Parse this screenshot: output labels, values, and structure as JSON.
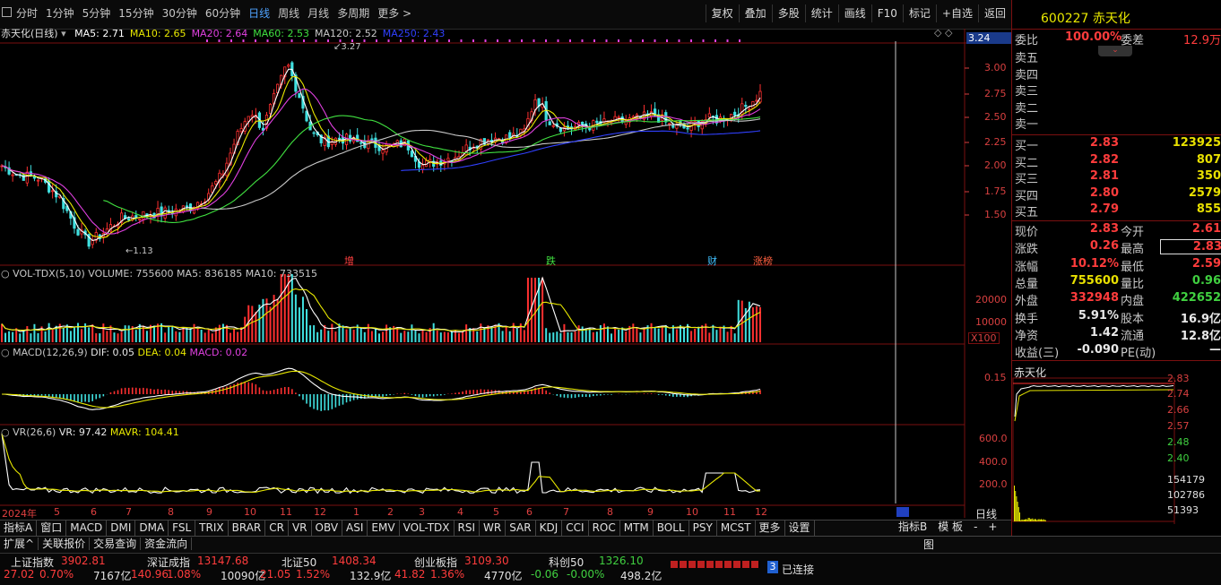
{
  "toolbar": {
    "periods": [
      "分时",
      "1分钟",
      "5分钟",
      "15分钟",
      "30分钟",
      "60分钟",
      "日线",
      "周线",
      "月线",
      "多周期",
      "更多 >"
    ],
    "active_period": "日线",
    "tools": [
      "复权",
      "叠加",
      "多股",
      "统计",
      "画线",
      "F10",
      "标记",
      "+自选",
      "返回"
    ]
  },
  "main_chart": {
    "title": "赤天化(日线)",
    "ma": [
      {
        "label": "MA5: 2.71",
        "color": "#ffffff"
      },
      {
        "label": "MA10: 2.65",
        "color": "#e8e800"
      },
      {
        "label": "MA20: 2.64",
        "color": "#e040e0"
      },
      {
        "label": "MA60: 2.53",
        "color": "#40e040"
      },
      {
        "label": "MA120: 2.52",
        "color": "#c8c8c8"
      },
      {
        "label": "MA250: 2.43",
        "color": "#3040ff"
      }
    ],
    "high_label": "3.27",
    "low_label": "1.13",
    "cursor_price": "3.24",
    "price_ticks": [
      "3.00",
      "2.75",
      "2.50",
      "2.25",
      "2.00",
      "1.75",
      "1.50"
    ],
    "events": [
      {
        "text": "增",
        "color": "#ff4040"
      },
      {
        "text": "跌",
        "color": "#40e040"
      },
      {
        "text": "财",
        "color": "#40c0ff"
      },
      {
        "text": "涨榜",
        "color": "#ff6040"
      }
    ]
  },
  "vol_panel": {
    "title": "VOL-TDX(5,10)",
    "values": "VOLUME: 755600  MA5: 836185  MA10: 733515",
    "ticks": [
      "20000",
      "10000",
      "X100"
    ]
  },
  "macd_panel": {
    "title": "MACD(12,26,9)",
    "dif": "DIF: 0.05",
    "dea": "DEA: 0.04",
    "macd": "MACD: 0.02",
    "ticks": [
      "0.15"
    ]
  },
  "vr_panel": {
    "title": "VR(26,6)",
    "vr": "VR: 97.42",
    "mavr": "MAVR: 104.41",
    "ticks": [
      "600.0",
      "400.0",
      "200.0"
    ]
  },
  "x_axis": [
    "2024年",
    "5",
    "6",
    "7",
    "8",
    "9",
    "10",
    "11",
    "12",
    "1",
    "2",
    "3",
    "4",
    "5",
    "6",
    "7",
    "8",
    "9",
    "10",
    "11",
    "12"
  ],
  "x_axis_right": "日线",
  "indicator_tabs": [
    "指标A",
    "窗口",
    "MACD",
    "DMI",
    "DMA",
    "FSL",
    "TRIX",
    "BRAR",
    "CR",
    "VR",
    "OBV",
    "ASI",
    "EMV",
    "VOL-TDX",
    "RSI",
    "WR",
    "SAR",
    "KDJ",
    "CCI",
    "ROC",
    "MTM",
    "BOLL",
    "PSY",
    "MCST",
    "更多",
    "设置"
  ],
  "indicator_tabs_right": [
    "指标B",
    "模 板",
    "-",
    "+"
  ],
  "bottom_tabs": [
    "扩展^",
    "关联报价",
    "交易查询",
    "资金流向"
  ],
  "bottom_tabs_right": "图",
  "quote": {
    "code": "600227",
    "name": "赤天化",
    "webi_label": "委比",
    "webi": "100.00%",
    "weicha_label": "委差",
    "weicha": "12.9万",
    "sell": [
      {
        "label": "卖五",
        "price": "",
        "vol": ""
      },
      {
        "label": "卖四",
        "price": "",
        "vol": ""
      },
      {
        "label": "卖三",
        "price": "",
        "vol": ""
      },
      {
        "label": "卖二",
        "price": "",
        "vol": ""
      },
      {
        "label": "卖一",
        "price": "",
        "vol": ""
      }
    ],
    "buy": [
      {
        "label": "买一",
        "price": "2.83",
        "vol": "123925"
      },
      {
        "label": "买二",
        "price": "2.82",
        "vol": "807"
      },
      {
        "label": "买三",
        "price": "2.81",
        "vol": "350"
      },
      {
        "label": "买四",
        "price": "2.80",
        "vol": "2579"
      },
      {
        "label": "买五",
        "price": "2.79",
        "vol": "855"
      }
    ],
    "stats": [
      {
        "l1": "现价",
        "v1": "2.83",
        "l2": "今开",
        "v2": "2.61"
      },
      {
        "l1": "涨跌",
        "v1": "0.26",
        "l2": "最高",
        "v2": "2.83"
      },
      {
        "l1": "涨幅",
        "v1": "10.12%",
        "l2": "最低",
        "v2": "2.59"
      },
      {
        "l1": "总量",
        "v1": "755600",
        "l2": "量比",
        "v2": "0.96"
      },
      {
        "l1": "外盘",
        "v1": "332948",
        "l2": "内盘",
        "v2": "422652"
      },
      {
        "l1": "换手",
        "v1": "5.91%",
        "l2": "股本",
        "v2": "16.9亿"
      },
      {
        "l1": "净资",
        "v1": "1.42",
        "l2": "流通",
        "v2": "12.8亿"
      },
      {
        "l1": "收益(三)",
        "v1": "-0.090",
        "l2": "PE(动)",
        "v2": "—"
      }
    ],
    "mini_title": "赤天化",
    "mini_ticks": [
      "2.83",
      "2.74",
      "2.66",
      "2.57",
      "2.48",
      "2.40"
    ],
    "mini_vol_ticks": [
      "154179",
      "102786",
      "51393"
    ]
  },
  "status": {
    "indices": [
      {
        "name": "上证指数",
        "price": "3902.81",
        "chg": "27.02",
        "pct": "0.70%",
        "amt": "7167亿"
      },
      {
        "name": "深证成指",
        "price": "13147.68",
        "chg": "140.96",
        "pct": "1.08%",
        "amt": "10090亿"
      },
      {
        "name": "北证50",
        "price": "1408.34",
        "chg": "21.05",
        "pct": "1.52%",
        "amt": "132.9亿"
      },
      {
        "name": "创业板指",
        "price": "3109.30",
        "chg": "41.82",
        "pct": "1.36%",
        "amt": "4770亿"
      },
      {
        "name": "科创50",
        "price": "1326.10",
        "chg": "-0.06",
        "pct": "-0.00%",
        "amt": "498.2亿"
      }
    ],
    "connections": "3",
    "connected_label": "已连接"
  }
}
